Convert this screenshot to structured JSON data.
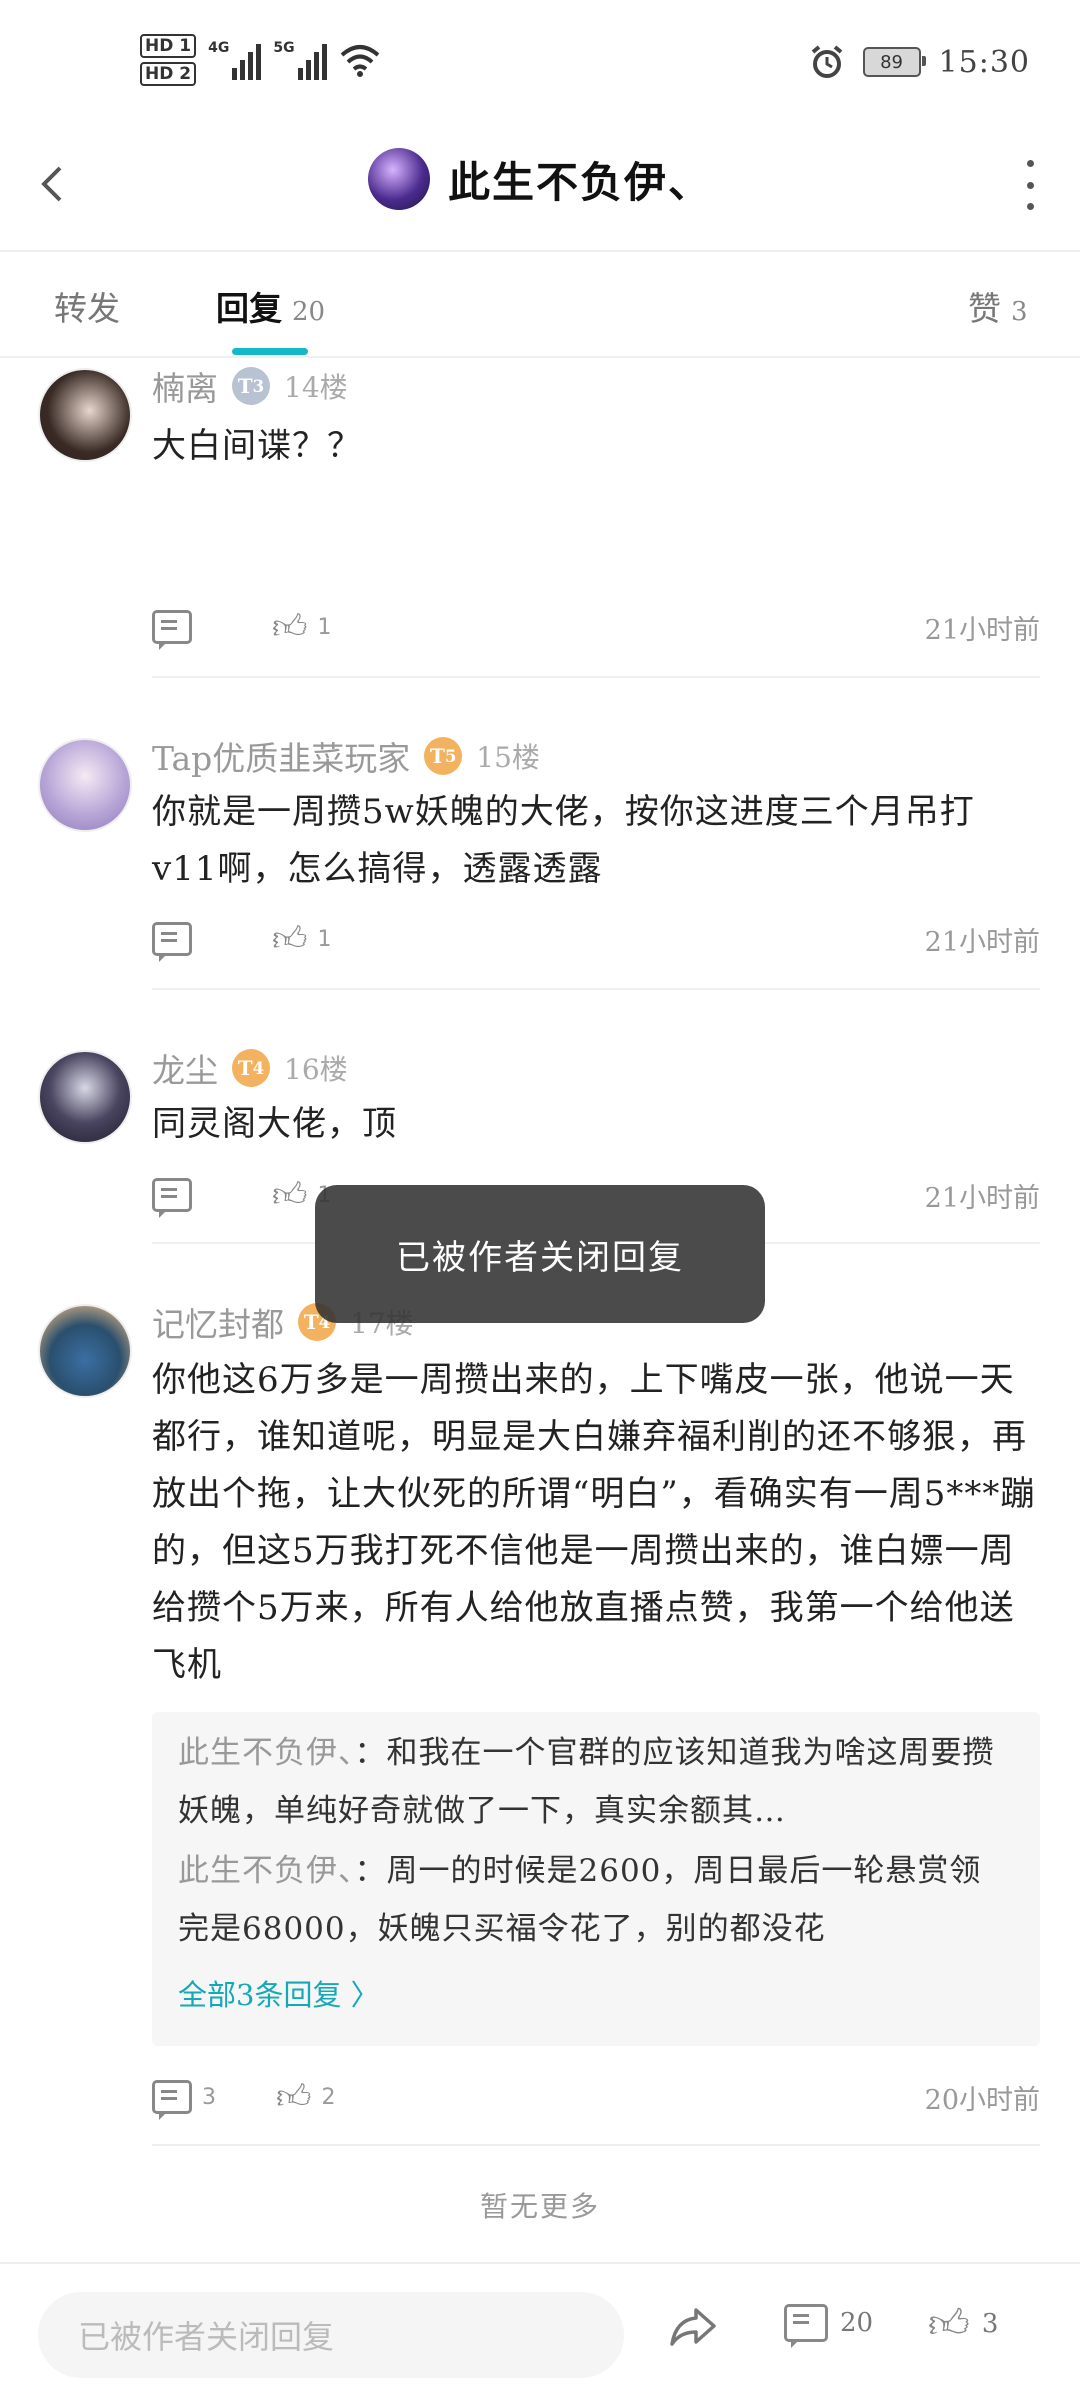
{
  "status_bar": {
    "hd1": "HD 1",
    "hd2": "HD 2",
    "net1": "4G",
    "net2": "5G",
    "battery": "89",
    "time": "15:30"
  },
  "header": {
    "title": "此生不负伊、"
  },
  "tabs": {
    "forward_label": "转发",
    "reply_label": "回复",
    "reply_count": "20",
    "like_label": "赞",
    "like_count": "3"
  },
  "comments": [
    {
      "name": "楠离",
      "level": "3",
      "floor": "14楼",
      "body": "大白间谍？？",
      "comment_count": "",
      "like_count": "1",
      "time": "21小时前"
    },
    {
      "name": "Tap优质韭菜玩家",
      "level": "5",
      "floor": "15楼",
      "body": "你就是一周攒5w妖魄的大佬，按你这进度三个月吊打v11啊，怎么搞得，透露透露",
      "comment_count": "",
      "like_count": "1",
      "time": "21小时前"
    },
    {
      "name": "龙尘",
      "level": "4",
      "floor": "16楼",
      "body": "同灵阁大佬，顶",
      "comment_count": "",
      "like_count": "1",
      "time": "21小时前"
    },
    {
      "name": "记忆封都",
      "level": "4",
      "floor": "17楼",
      "body": "你他这6万多是一周攒出来的，上下嘴皮一张，他说一天都行，谁知道呢，明显是大白嫌弃福利削的还不够狠，再放出个拖，让大伙死的所谓“明白”，看确实有一周5***蹦的，但这5万我打死不信他是一周攒出来的，谁白嫖一周给攒个5万来，所有人给他放直播点赞，我第一个给他送飞机",
      "comment_count": "3",
      "like_count": "2",
      "time": "20小时前",
      "replies": [
        {
          "name": "此生不负伊、",
          "text": "：和我在一个官群的应该知道我为啥这周要攒妖魄，单纯好奇就做了一下，真实余额其…"
        },
        {
          "name": "此生不负伊、",
          "text": "：周一的时候是2600，周日最后一轮悬赏领完是68000，妖魄只买福令花了，别的都没花"
        }
      ],
      "all_replies": "全部3条回复 〉"
    }
  ],
  "no_more": "暂无更多",
  "toast": "已被作者关闭回复",
  "bottom_bar": {
    "input_placeholder": "已被作者关闭回复",
    "comment_count": "20",
    "like_count": "3"
  },
  "icons": [
    "back-icon",
    "more-icon",
    "comment-icon",
    "like-icon",
    "share-icon"
  ]
}
